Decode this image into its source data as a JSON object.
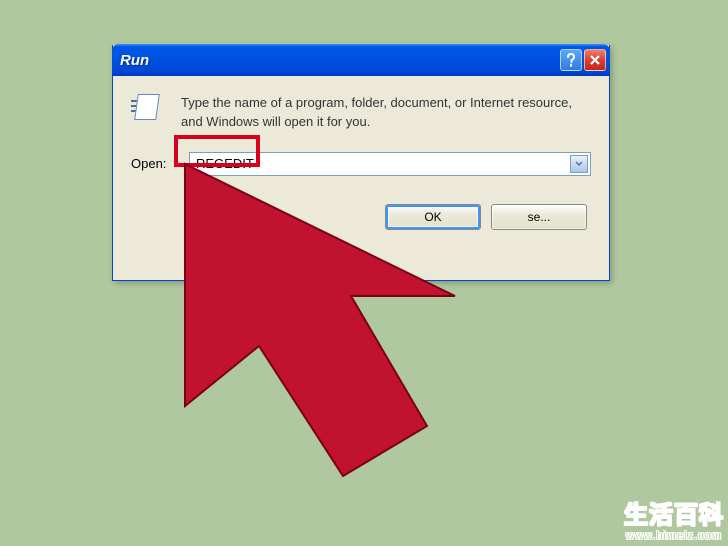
{
  "window": {
    "title": "Run",
    "info_text": "Type the name of a program, folder, document, or Internet resource, and Windows will open it for you.",
    "open_label": "Open:",
    "open_value": "REGEDIT",
    "buttons": {
      "ok": "OK",
      "browse": "se..."
    }
  },
  "watermark": {
    "chinese": "生活百科",
    "url": "www.bimeiz.com"
  },
  "colors": {
    "background": "#b0c89f",
    "titlebar_blue": "#0054e3",
    "highlight_red": "#d8001a",
    "arrow_red": "#c1122f"
  }
}
